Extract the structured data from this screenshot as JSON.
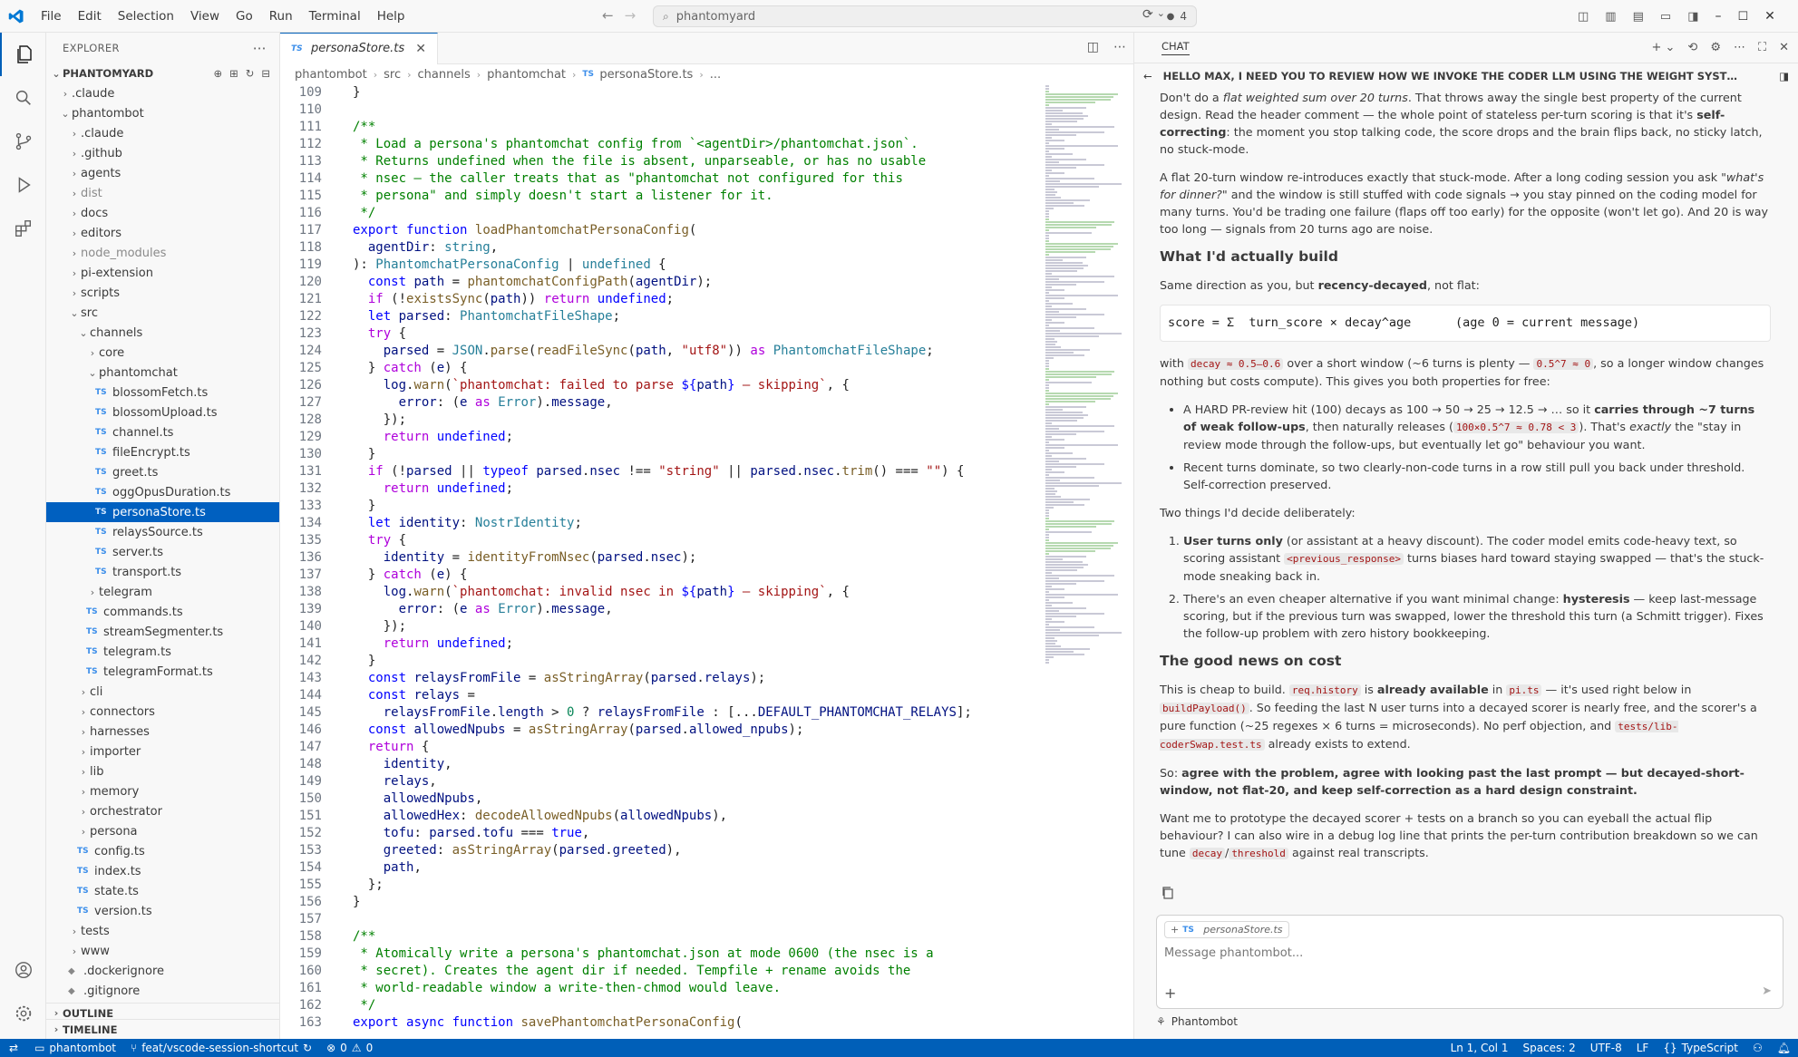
{
  "menu": [
    "File",
    "Edit",
    "Selection",
    "View",
    "Go",
    "Run",
    "Terminal",
    "Help"
  ],
  "search": {
    "text": "phantomyard",
    "count": "4"
  },
  "explorer": {
    "title": "EXPLORER",
    "root": "PHANTOMYARD",
    "tree": [
      {
        "label": ".claude",
        "depth": 1,
        "kind": "folder",
        "open": false
      },
      {
        "label": "phantombot",
        "depth": 1,
        "kind": "folder",
        "open": true
      },
      {
        "label": ".claude",
        "depth": 2,
        "kind": "folder",
        "open": false
      },
      {
        "label": ".github",
        "depth": 2,
        "kind": "folder",
        "open": false
      },
      {
        "label": "agents",
        "depth": 2,
        "kind": "folder",
        "open": false
      },
      {
        "label": "dist",
        "depth": 2,
        "kind": "folder",
        "open": false,
        "dim": true
      },
      {
        "label": "docs",
        "depth": 2,
        "kind": "folder",
        "open": false
      },
      {
        "label": "editors",
        "depth": 2,
        "kind": "folder",
        "open": false
      },
      {
        "label": "node_modules",
        "depth": 2,
        "kind": "folder",
        "open": false,
        "dim": true
      },
      {
        "label": "pi-extension",
        "depth": 2,
        "kind": "folder",
        "open": false
      },
      {
        "label": "scripts",
        "depth": 2,
        "kind": "folder",
        "open": false
      },
      {
        "label": "src",
        "depth": 2,
        "kind": "folder",
        "open": true
      },
      {
        "label": "channels",
        "depth": 3,
        "kind": "folder",
        "open": true
      },
      {
        "label": "core",
        "depth": 4,
        "kind": "folder",
        "open": false
      },
      {
        "label": "phantomchat",
        "depth": 4,
        "kind": "folder",
        "open": true
      },
      {
        "label": "blossomFetch.ts",
        "depth": 5,
        "kind": "ts"
      },
      {
        "label": "blossomUpload.ts",
        "depth": 5,
        "kind": "ts"
      },
      {
        "label": "channel.ts",
        "depth": 5,
        "kind": "ts"
      },
      {
        "label": "fileEncrypt.ts",
        "depth": 5,
        "kind": "ts"
      },
      {
        "label": "greet.ts",
        "depth": 5,
        "kind": "ts"
      },
      {
        "label": "oggOpusDuration.ts",
        "depth": 5,
        "kind": "ts"
      },
      {
        "label": "personaStore.ts",
        "depth": 5,
        "kind": "ts",
        "selected": true
      },
      {
        "label": "relaysSource.ts",
        "depth": 5,
        "kind": "ts"
      },
      {
        "label": "server.ts",
        "depth": 5,
        "kind": "ts"
      },
      {
        "label": "transport.ts",
        "depth": 5,
        "kind": "ts"
      },
      {
        "label": "telegram",
        "depth": 4,
        "kind": "folder",
        "open": false
      },
      {
        "label": "commands.ts",
        "depth": 4,
        "kind": "ts"
      },
      {
        "label": "streamSegmenter.ts",
        "depth": 4,
        "kind": "ts"
      },
      {
        "label": "telegram.ts",
        "depth": 4,
        "kind": "ts"
      },
      {
        "label": "telegramFormat.ts",
        "depth": 4,
        "kind": "ts"
      },
      {
        "label": "cli",
        "depth": 3,
        "kind": "folder",
        "open": false
      },
      {
        "label": "connectors",
        "depth": 3,
        "kind": "folder",
        "open": false
      },
      {
        "label": "harnesses",
        "depth": 3,
        "kind": "folder",
        "open": false
      },
      {
        "label": "importer",
        "depth": 3,
        "kind": "folder",
        "open": false
      },
      {
        "label": "lib",
        "depth": 3,
        "kind": "folder",
        "open": false
      },
      {
        "label": "memory",
        "depth": 3,
        "kind": "folder",
        "open": false
      },
      {
        "label": "orchestrator",
        "depth": 3,
        "kind": "folder",
        "open": false
      },
      {
        "label": "persona",
        "depth": 3,
        "kind": "folder",
        "open": false
      },
      {
        "label": "config.ts",
        "depth": 3,
        "kind": "ts"
      },
      {
        "label": "index.ts",
        "depth": 3,
        "kind": "ts"
      },
      {
        "label": "state.ts",
        "depth": 3,
        "kind": "ts"
      },
      {
        "label": "version.ts",
        "depth": 3,
        "kind": "ts"
      },
      {
        "label": "tests",
        "depth": 2,
        "kind": "folder",
        "open": false
      },
      {
        "label": "www",
        "depth": 2,
        "kind": "folder",
        "open": false
      },
      {
        "label": ".dockerignore",
        "depth": 2,
        "kind": "file"
      },
      {
        "label": ".gitignore",
        "depth": 2,
        "kind": "file"
      }
    ],
    "outline": "OUTLINE",
    "timeline": "TIMELINE"
  },
  "editor": {
    "tab": "personaStore.ts",
    "breadcrumb": [
      "phantombot",
      "src",
      "channels",
      "phantomchat",
      "personaStore.ts",
      "..."
    ],
    "lines": [
      {
        "n": "109",
        "h": "}"
      },
      {
        "n": "110",
        "h": ""
      },
      {
        "n": "111",
        "h": "<span class='c'>/**</span>"
      },
      {
        "n": "112",
        "h": "<span class='c'> * Load a persona's phantomchat config from `&lt;agentDir&gt;/phantomchat.json`.</span>"
      },
      {
        "n": "113",
        "h": "<span class='c'> * Returns undefined when the file is absent, unparseable, or has no usable</span>"
      },
      {
        "n": "114",
        "h": "<span class='c'> * nsec — the caller treats that as \"phantomchat not configured for this</span>"
      },
      {
        "n": "115",
        "h": "<span class='c'> * persona\" and simply doesn't start a listener for it.</span>"
      },
      {
        "n": "116",
        "h": "<span class='c'> */</span>"
      },
      {
        "n": "117",
        "h": "<span class='k'>export</span> <span class='k'>function</span> <span class='f'>loadPhantomchatPersonaConfig</span>("
      },
      {
        "n": "118",
        "h": "  <span class='v'>agentDir</span>: <span class='t'>string</span>,"
      },
      {
        "n": "119",
        "h": "): <span class='t'>PhantomchatPersonaConfig</span> | <span class='t'>undefined</span> {"
      },
      {
        "n": "120",
        "h": "  <span class='k'>const</span> <span class='v'>path</span> = <span class='f'>phantomchatConfigPath</span>(<span class='v'>agentDir</span>);"
      },
      {
        "n": "121",
        "h": "  <span class='kc'>if</span> (!<span class='f'>existsSync</span>(<span class='v'>path</span>)) <span class='kc'>return</span> <span class='k'>undefined</span>;"
      },
      {
        "n": "122",
        "h": "  <span class='k'>let</span> <span class='v'>parsed</span>: <span class='t'>PhantomchatFileShape</span>;"
      },
      {
        "n": "123",
        "h": "  <span class='kc'>try</span> {"
      },
      {
        "n": "124",
        "h": "    <span class='v'>parsed</span> = <span class='t'>JSON</span>.<span class='f'>parse</span>(<span class='f'>readFileSync</span>(<span class='v'>path</span>, <span class='s'>\"utf8\"</span>)) <span class='kc'>as</span> <span class='t'>PhantomchatFileShape</span>;"
      },
      {
        "n": "125",
        "h": "  } <span class='kc'>catch</span> (<span class='v'>e</span>) {"
      },
      {
        "n": "126",
        "h": "    <span class='v'>log</span>.<span class='f'>warn</span>(<span class='s'>`phantomchat: failed to parse </span><span class='k'>${</span><span class='v'>path</span><span class='k'>}</span><span class='s'> — skipping`</span>, {"
      },
      {
        "n": "127",
        "h": "      <span class='v'>error</span>: (<span class='v'>e</span> <span class='kc'>as</span> <span class='t'>Error</span>).<span class='v'>message</span>,"
      },
      {
        "n": "128",
        "h": "    });"
      },
      {
        "n": "129",
        "h": "    <span class='kc'>return</span> <span class='k'>undefined</span>;"
      },
      {
        "n": "130",
        "h": "  }"
      },
      {
        "n": "131",
        "h": "  <span class='kc'>if</span> (!<span class='v'>parsed</span> || <span class='k'>typeof</span> <span class='v'>parsed</span>.<span class='v'>nsec</span> !== <span class='s'>\"string\"</span> || <span class='v'>parsed</span>.<span class='v'>nsec</span>.<span class='f'>trim</span>() === <span class='s'>\"\"</span>) {"
      },
      {
        "n": "132",
        "h": "    <span class='kc'>return</span> <span class='k'>undefined</span>;"
      },
      {
        "n": "133",
        "h": "  }"
      },
      {
        "n": "134",
        "h": "  <span class='k'>let</span> <span class='v'>identity</span>: <span class='t'>NostrIdentity</span>;"
      },
      {
        "n": "135",
        "h": "  <span class='kc'>try</span> {"
      },
      {
        "n": "136",
        "h": "    <span class='v'>identity</span> = <span class='f'>identityFromNsec</span>(<span class='v'>parsed</span>.<span class='v'>nsec</span>);"
      },
      {
        "n": "137",
        "h": "  } <span class='kc'>catch</span> (<span class='v'>e</span>) {"
      },
      {
        "n": "138",
        "h": "    <span class='v'>log</span>.<span class='f'>warn</span>(<span class='s'>`phantomchat: invalid nsec in </span><span class='k'>${</span><span class='v'>path</span><span class='k'>}</span><span class='s'> — skipping`</span>, {"
      },
      {
        "n": "139",
        "h": "      <span class='v'>error</span>: (<span class='v'>e</span> <span class='kc'>as</span> <span class='t'>Error</span>).<span class='v'>message</span>,"
      },
      {
        "n": "140",
        "h": "    });"
      },
      {
        "n": "141",
        "h": "    <span class='kc'>return</span> <span class='k'>undefined</span>;"
      },
      {
        "n": "142",
        "h": "  }"
      },
      {
        "n": "143",
        "h": "  <span class='k'>const</span> <span class='v'>relaysFromFile</span> = <span class='f'>asStringArray</span>(<span class='v'>parsed</span>.<span class='v'>relays</span>);"
      },
      {
        "n": "144",
        "h": "  <span class='k'>const</span> <span class='v'>relays</span> ="
      },
      {
        "n": "145",
        "h": "    <span class='v'>relaysFromFile</span>.<span class='v'>length</span> &gt; <span class='n'>0</span> ? <span class='v'>relaysFromFile</span> : [...<span class='v'>DEFAULT_PHANTOMCHAT_RELAYS</span>];"
      },
      {
        "n": "146",
        "h": "  <span class='k'>const</span> <span class='v'>allowedNpubs</span> = <span class='f'>asStringArray</span>(<span class='v'>parsed</span>.<span class='v'>allowed_npubs</span>);"
      },
      {
        "n": "147",
        "h": "  <span class='kc'>return</span> {"
      },
      {
        "n": "148",
        "h": "    <span class='v'>identity</span>,"
      },
      {
        "n": "149",
        "h": "    <span class='v'>relays</span>,"
      },
      {
        "n": "150",
        "h": "    <span class='v'>allowedNpubs</span>,"
      },
      {
        "n": "151",
        "h": "    <span class='v'>allowedHex</span>: <span class='f'>decodeAllowedNpubs</span>(<span class='v'>allowedNpubs</span>),"
      },
      {
        "n": "152",
        "h": "    <span class='v'>tofu</span>: <span class='v'>parsed</span>.<span class='v'>tofu</span> === <span class='k'>true</span>,"
      },
      {
        "n": "153",
        "h": "    <span class='v'>greeted</span>: <span class='f'>asStringArray</span>(<span class='v'>parsed</span>.<span class='v'>greeted</span>),"
      },
      {
        "n": "154",
        "h": "    <span class='v'>path</span>,"
      },
      {
        "n": "155",
        "h": "  };"
      },
      {
        "n": "156",
        "h": "}"
      },
      {
        "n": "157",
        "h": ""
      },
      {
        "n": "158",
        "h": "<span class='c'>/**</span>"
      },
      {
        "n": "159",
        "h": "<span class='c'> * Atomically write a persona's phantomchat.json at mode 0600 (the nsec is a</span>"
      },
      {
        "n": "160",
        "h": "<span class='c'> * secret). Creates the agent dir if needed. Tempfile + rename avoids the</span>"
      },
      {
        "n": "161",
        "h": "<span class='c'> * world-readable window a write-then-chmod would leave.</span>"
      },
      {
        "n": "162",
        "h": "<span class='c'> */</span>"
      },
      {
        "n": "163",
        "h": "<span class='k'>export</span> <span class='k'>async</span> <span class='k'>function</span> <span class='f'>savePhantomchatPersonaConfig</span>("
      }
    ]
  },
  "chat": {
    "header": "CHAT",
    "title": "HELLO MAX, I NEED YOU TO REVIEW HOW WE INVOKE THE CODER LLM USING THE WEIGHT SYSTEM SIMILAR TO MODS...",
    "body_html": "<p>Don't do a <i>flat weighted sum over 20 turns</i>. That throws away the single best property of the current design. Read the header comment — the whole point of stateless per-turn scoring is that it's <b>self-correcting</b>: the moment you stop talking code, the score drops and the brain flips back, no sticky latch, no stuck-mode.</p><p>A flat 20-turn window re-introduces exactly that stuck-mode. After a long coding session you ask <i>\"what's for dinner?\"</i> and the window is still stuffed with code signals → you stay pinned on the coding model for many turns. You'd be trading one failure (flaps off too early) for the opposite (won't let go). And 20 is way too long — signals from 20 turns ago are noise.</p><h3>What I'd actually build</h3><p>Same direction as you, but <b>recency-decayed</b>, not flat:</p><div class='formula'>score = Σ  turn_score × decay^age      (age 0 = current message)</div><p>with <span class='code-inline'>decay ≈ 0.5–0.6</span> over a short window (~6 turns is plenty — <span class='code-inline'>0.5^7 ≈ 0</span>, so a longer window changes nothing but costs compute). This gives you both properties for free:</p><ul><li>A HARD PR-review hit (100) decays as 100 → 50 → 25 → 12.5 → … so it <b>carries through ~7 turns of weak follow-ups</b>, then naturally releases (<span class='code-inline'>100×0.5^7 ≈ 0.78 &lt; 3</span>). That's <i>exactly</i> the \"stay in review mode through the follow-ups, but eventually let go\" behaviour you want.</li><li>Recent turns dominate, so two clearly-non-code turns in a row still pull you back under threshold. Self-correction preserved.</li></ul><p>Two things I'd decide deliberately:</p><ol><li><b>User turns only</b> (or assistant at a heavy discount). The coder model emits code-heavy text, so scoring assistant <span class='code-inline'>&lt;previous_response&gt;</span> turns biases hard toward staying swapped — that's the stuck-mode sneaking back in.</li><li>There's an even cheaper alternative if you want minimal change: <b>hysteresis</b> — keep last-message scoring, but if the previous turn was swapped, lower the threshold this turn (a Schmitt trigger). Fixes the follow-up problem with zero history bookkeeping.</li></ol><h3>The good news on cost</h3><p>This is cheap to build. <span class='code-inline'>req.history</span> is <b>already available</b> in <span class='code-inline'>pi.ts</span> — it's used right below in <span class='code-inline'>buildPayload()</span>. So feeding the last N user turns into a decayed scorer is nearly free, and the scorer's a pure function (~25 regexes × 6 turns = microseconds). No perf objection, and <span class='code-inline'>tests/lib-coderSwap.test.ts</span> already exists to extend.</p><p>So: <b>agree with the problem, agree with looking past the last prompt — but decayed-short-window, not flat-20, and keep self-correction as a hard design constraint.</b></p><p>Want me to prototype the decayed scorer + tests on a branch so you can eyeball the actual flip behaviour? I can also wire in a debug log line that prints the per-turn contribution breakdown so we can tune <span class='code-inline'>decay</span>/<span class='code-inline'>threshold</span> against real transcripts.</p>",
    "attachment": "personaStore.ts",
    "placeholder": "Message phantombot...",
    "agent": "Phantombot"
  },
  "status": {
    "repo": "phantombot",
    "branch": "feat/vscode-session-shortcut",
    "problems": "0",
    "warnings": "0",
    "cursor": "Ln 1, Col 1",
    "spaces": "Spaces: 2",
    "encoding": "UTF-8",
    "eol": "LF",
    "language": "TypeScript"
  },
  "colors": {
    "accent": "#005fb8",
    "selection": "#0060c0"
  }
}
